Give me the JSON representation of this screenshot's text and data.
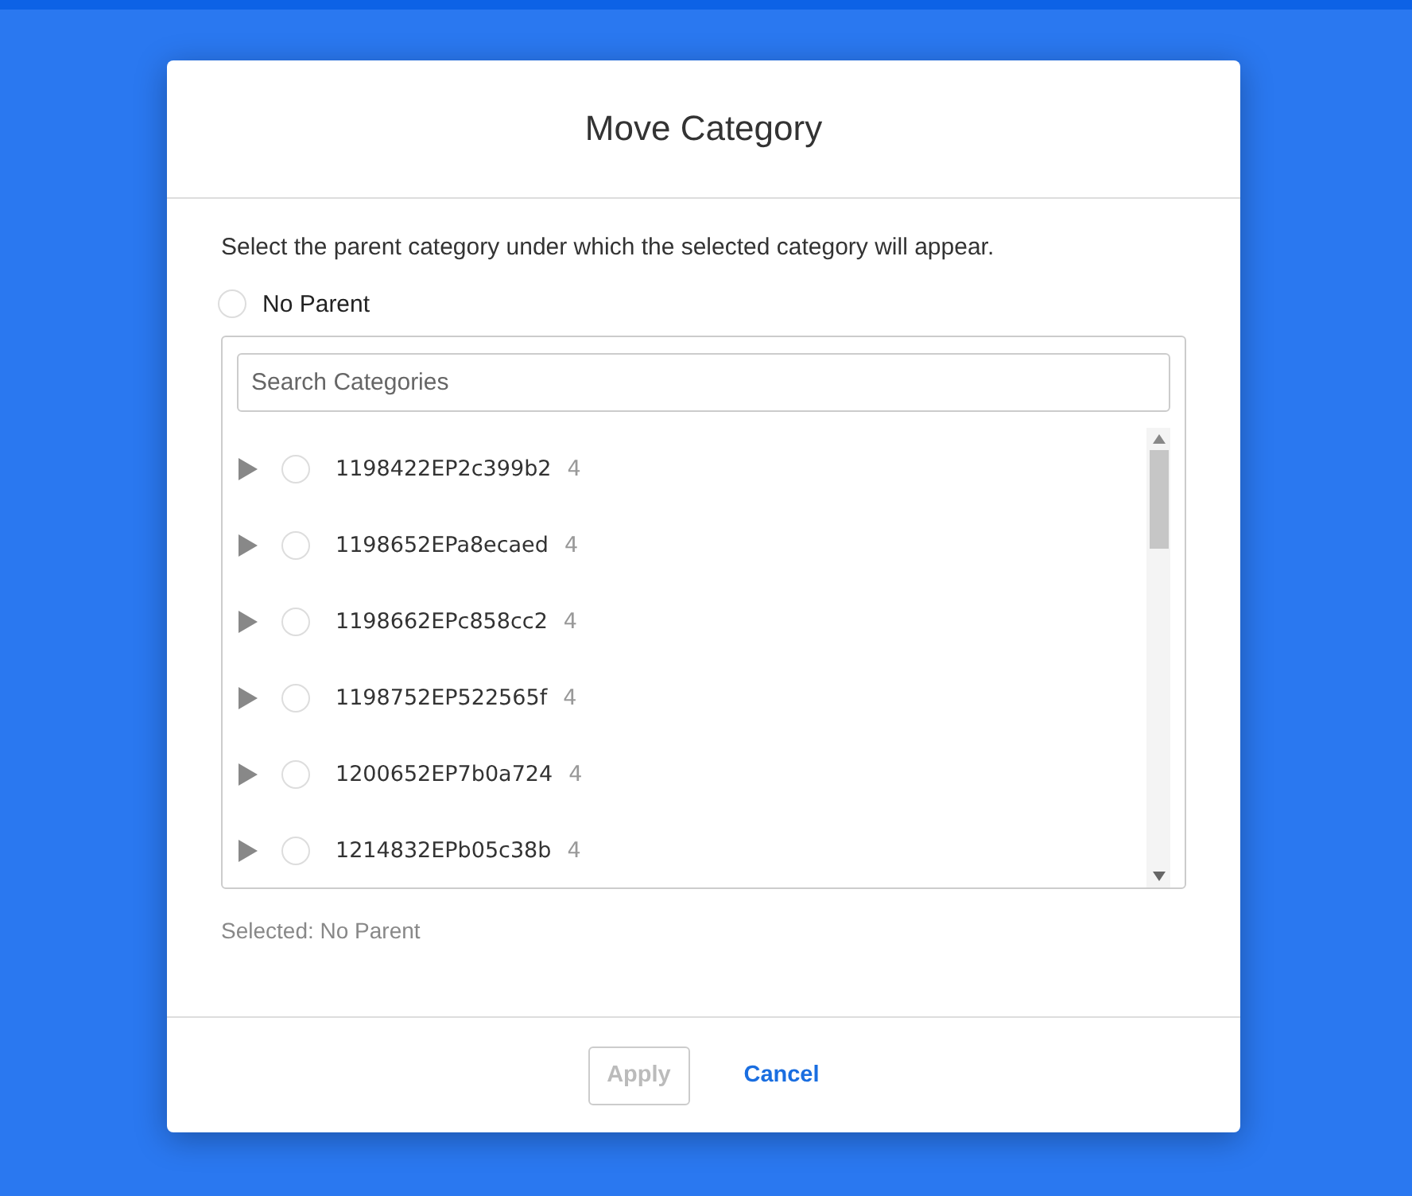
{
  "dialog": {
    "title": "Move Category",
    "instruction": "Select the parent category under which the selected category will appear.",
    "no_parent": {
      "label": "No Parent",
      "selected": false
    },
    "search": {
      "placeholder": "Search Categories"
    },
    "categories": [
      {
        "name": "1198422EP2c399b2",
        "count": "4",
        "expanded": false,
        "selected": false
      },
      {
        "name": "1198652EPa8ecaed",
        "count": "4",
        "expanded": false,
        "selected": false
      },
      {
        "name": "1198662EPc858cc2",
        "count": "4",
        "expanded": false,
        "selected": false
      },
      {
        "name": "1198752EP522565f",
        "count": "4",
        "expanded": false,
        "selected": false
      },
      {
        "name": "1200652EP7b0a724",
        "count": "4",
        "expanded": false,
        "selected": false
      },
      {
        "name": "1214832EPb05c38b",
        "count": "4",
        "expanded": false,
        "selected": false
      }
    ],
    "selection_text": "Selected: No Parent",
    "buttons": [
      {
        "label": "Apply",
        "kind": "secondary",
        "disabled": true
      },
      {
        "label": "Cancel",
        "kind": "link",
        "disabled": false
      }
    ]
  }
}
